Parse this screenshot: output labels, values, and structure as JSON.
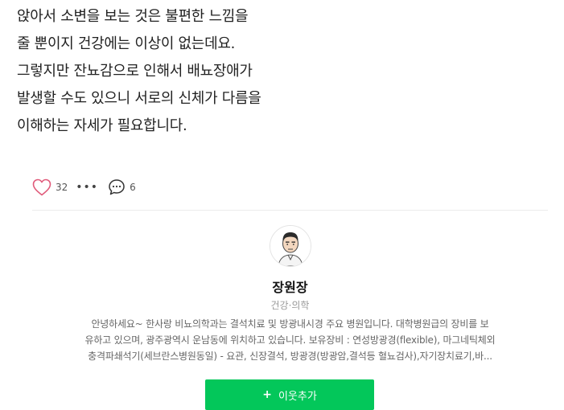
{
  "article": {
    "lines": [
      "앉아서 소변을 보는 것은 불편한 느낌을",
      "줄 뿐이지 건강에는 이상이 없는데요.",
      "그렇지만 잔뇨감으로 인해서 배뇨장애가",
      "발생할 수도 있으니 서로의 신체가 다름을",
      "이해하는 자세가 필요합니다."
    ]
  },
  "actions": {
    "like_count": "32",
    "more_label": "•••",
    "comment_count": "6",
    "like_icon": "heart-outline-icon",
    "comment_icon": "speech-bubble-icon"
  },
  "profile": {
    "blog_name": "장원장",
    "category": "건강·의학",
    "intro_lines": [
      "안녕하세요~ 한사랑 비뇨의학과는 결석치료 및 방광내시경 주요 병원입니다. 대학병원급의 장비를 보",
      "유하고 있으며, 광주광역시 운남동에 위치하고 있습니다. 보유장비 : 연성방광경(flexible), 마그네틱체외",
      "충격파쇄석기(세브란스병원동일) - 요관, 신장결석, 방광경(방광암,결석등 혈뇨검사),자기장치료기,바..."
    ],
    "add_button_plus": "+",
    "add_button_label": "이웃추가"
  },
  "colors": {
    "accent_green": "#03c75a",
    "heart_pink": "#e05a7a"
  }
}
